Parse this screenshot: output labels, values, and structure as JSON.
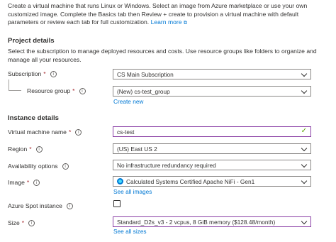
{
  "intro": {
    "text": "Create a virtual machine that runs Linux or Windows. Select an image from Azure marketplace or use your own customized image. Complete the Basics tab then Review + create to provision a virtual machine with default parameters or review each tab for full customization.",
    "learn_more": "Learn more",
    "learn_more_icon": "external-link-icon"
  },
  "project": {
    "heading": "Project details",
    "description": "Select the subscription to manage deployed resources and costs. Use resource groups like folders to organize and manage all your resources.",
    "subscription": {
      "label": "Subscription",
      "value": "CS Main Subscription"
    },
    "resource_group": {
      "label": "Resource group",
      "value": "(New) cs-test_group",
      "create_new": "Create new"
    }
  },
  "instance": {
    "heading": "Instance details",
    "vm_name": {
      "label": "Virtual machine name",
      "value": "cs-test"
    },
    "region": {
      "label": "Region",
      "value": "(US) East US 2"
    },
    "availability": {
      "label": "Availability options",
      "value": "No infrastructure redundancy required"
    },
    "image": {
      "label": "Image",
      "value": "Calculated Systems Certified Apache NiFi - Gen1",
      "see_all": "See all images"
    },
    "spot": {
      "label": "Azure Spot instance"
    },
    "size": {
      "label": "Size",
      "value": "Standard_D2s_v3 - 2 vcpus, 8 GiB memory ($128.48/month)",
      "see_all": "See all sizes"
    }
  },
  "symbols": {
    "required": "*",
    "info": "i",
    "check": "✓"
  },
  "colors": {
    "link": "#0078d4",
    "required": "#a4262c",
    "valid": "#57a300",
    "focus_border": "#8a3fa5"
  }
}
